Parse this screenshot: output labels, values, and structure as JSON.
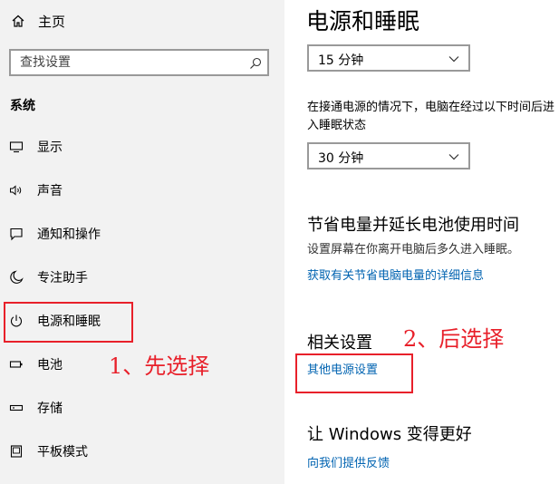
{
  "sidebar": {
    "home_label": "主页",
    "search_placeholder": "查找设置",
    "section_title": "系统",
    "items": [
      {
        "label": "显示",
        "icon": "monitor-icon"
      },
      {
        "label": "声音",
        "icon": "speaker-icon"
      },
      {
        "label": "通知和操作",
        "icon": "notification-icon"
      },
      {
        "label": "专注助手",
        "icon": "moon-icon"
      },
      {
        "label": "电源和睡眠",
        "icon": "power-icon"
      },
      {
        "label": "电池",
        "icon": "battery-icon"
      },
      {
        "label": "存储",
        "icon": "storage-icon"
      },
      {
        "label": "平板模式",
        "icon": "tablet-icon"
      }
    ]
  },
  "main": {
    "title": "电源和睡眠",
    "screen_timeout_value": "15 分钟",
    "sleep_description": "在接通电源的情况下，电脑在经过以下时间后进入睡眠状态",
    "sleep_timeout_value": "30 分钟",
    "battery_heading": "节省电量并延长电池使用时间",
    "battery_description": "设置屏幕在你离开电脑后多久进入睡眠。",
    "battery_link": "获取有关节省电脑电量的详细信息",
    "related_heading": "相关设置",
    "related_link": "其他电源设置",
    "improve_heading": "让 Windows 变得更好",
    "feedback_link": "向我们提供反馈"
  },
  "annotations": {
    "step1": "1、先选择",
    "step2": "2、后选择"
  },
  "colors": {
    "sidebar_bg": "#f2f2f2",
    "link": "#0063b1",
    "annotation_red": "#e8202a"
  }
}
